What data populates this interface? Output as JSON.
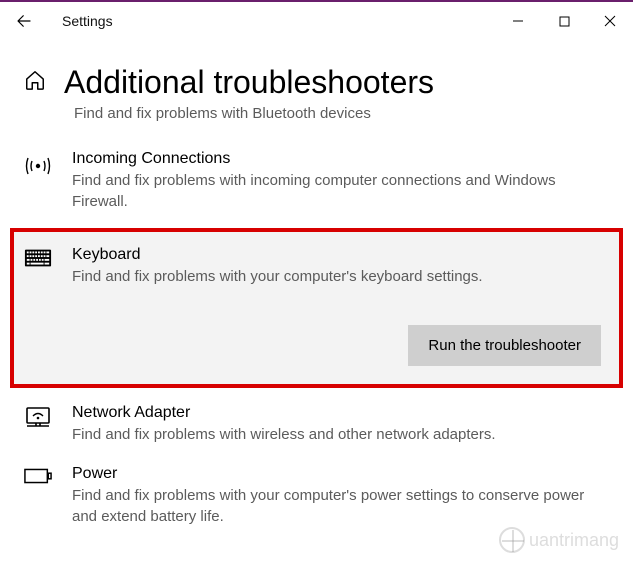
{
  "window": {
    "title": "Settings"
  },
  "header": {
    "page_title": "Additional troubleshooters"
  },
  "truncated_prev_desc": "Find and fix problems with Bluetooth devices",
  "items": {
    "incoming": {
      "title": "Incoming Connections",
      "desc": "Find and fix problems with incoming computer connections and Windows Firewall."
    },
    "keyboard": {
      "title": "Keyboard",
      "desc": "Find and fix problems with your computer's keyboard settings.",
      "run_label": "Run the troubleshooter"
    },
    "network": {
      "title": "Network Adapter",
      "desc": "Find and fix problems with wireless and other network adapters."
    },
    "power": {
      "title": "Power",
      "desc": "Find and fix problems with your computer's power settings to conserve power and extend battery life."
    }
  },
  "watermark": "uantrimang"
}
